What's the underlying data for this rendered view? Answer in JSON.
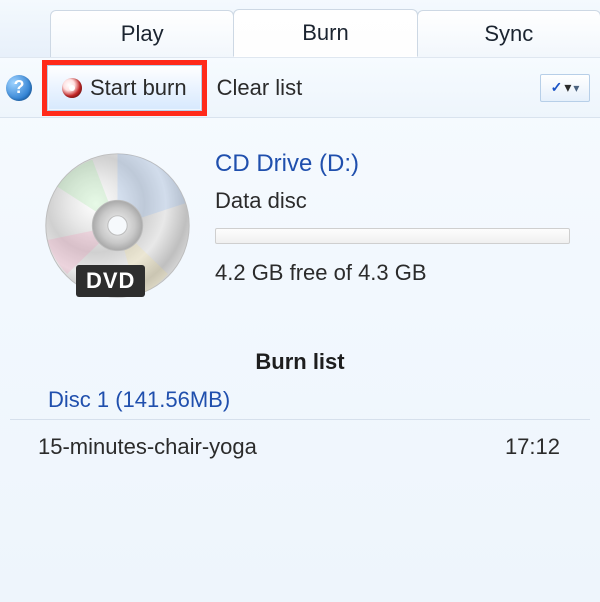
{
  "tabs": {
    "play": "Play",
    "burn": "Burn",
    "sync": "Sync",
    "active": "burn"
  },
  "toolbar": {
    "start_burn_label": "Start burn",
    "clear_list_label": "Clear list"
  },
  "drive": {
    "title": "CD Drive (D:)",
    "type": "Data disc",
    "free_text": "4.2 GB free of 4.3 GB",
    "badge": "DVD"
  },
  "list": {
    "header": "Burn list",
    "disc_label": "Disc 1 (141.56MB)",
    "tracks": [
      {
        "name": "15-minutes-chair-yoga",
        "duration": "17:12"
      }
    ]
  }
}
